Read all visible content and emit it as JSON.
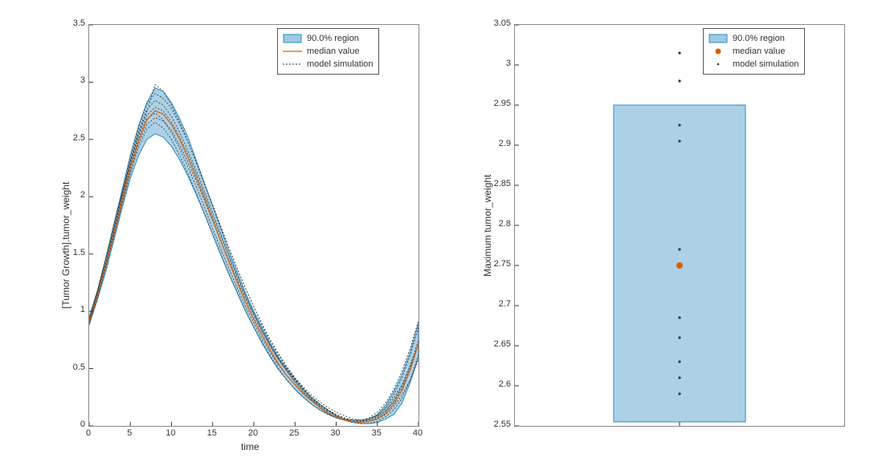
{
  "chart_data": [
    {
      "type": "line",
      "title": "",
      "xlabel": "time",
      "ylabel": "[Tumor Growth].tumor_weight",
      "xlim": [
        0,
        40
      ],
      "ylim": [
        0,
        3.5
      ],
      "xticks": [
        0,
        5,
        10,
        15,
        20,
        25,
        30,
        35,
        40
      ],
      "yticks": [
        0,
        0.5,
        1,
        1.5,
        2,
        2.5,
        3,
        3.5
      ],
      "x": [
        0,
        1,
        2,
        3,
        4,
        5,
        6,
        7,
        8,
        9,
        10,
        11,
        12,
        13,
        14,
        15,
        16,
        17,
        18,
        19,
        20,
        21,
        22,
        23,
        24,
        25,
        26,
        27,
        28,
        29,
        30,
        31,
        32,
        33,
        34,
        35,
        36,
        37,
        38,
        39,
        40
      ],
      "region_lower": [
        0.88,
        1.1,
        1.34,
        1.62,
        1.9,
        2.16,
        2.36,
        2.5,
        2.55,
        2.52,
        2.44,
        2.32,
        2.18,
        2.02,
        1.85,
        1.67,
        1.49,
        1.32,
        1.16,
        1.0,
        0.86,
        0.72,
        0.6,
        0.49,
        0.4,
        0.32,
        0.25,
        0.19,
        0.14,
        0.1,
        0.07,
        0.05,
        0.03,
        0.02,
        0.02,
        0.03,
        0.06,
        0.1,
        0.2,
        0.38,
        0.6
      ],
      "region_upper": [
        0.95,
        1.18,
        1.46,
        1.76,
        2.06,
        2.36,
        2.62,
        2.82,
        2.95,
        2.92,
        2.82,
        2.68,
        2.52,
        2.32,
        2.12,
        1.92,
        1.72,
        1.52,
        1.34,
        1.16,
        1.0,
        0.86,
        0.72,
        0.6,
        0.5,
        0.41,
        0.32,
        0.25,
        0.19,
        0.14,
        0.09,
        0.06,
        0.05,
        0.05,
        0.06,
        0.1,
        0.18,
        0.3,
        0.45,
        0.65,
        0.9
      ],
      "series": [
        {
          "name": "median value",
          "values": [
            0.91,
            1.14,
            1.4,
            1.68,
            1.97,
            2.25,
            2.49,
            2.67,
            2.75,
            2.72,
            2.63,
            2.5,
            2.34,
            2.17,
            1.99,
            1.8,
            1.61,
            1.43,
            1.25,
            1.08,
            0.93,
            0.79,
            0.66,
            0.54,
            0.44,
            0.36,
            0.28,
            0.22,
            0.16,
            0.11,
            0.08,
            0.05,
            0.04,
            0.03,
            0.04,
            0.06,
            0.11,
            0.19,
            0.31,
            0.49,
            0.72
          ]
        },
        {
          "name": "sim1",
          "values": [
            0.92,
            1.15,
            1.41,
            1.7,
            2.0,
            2.28,
            2.51,
            2.68,
            2.73,
            2.67,
            2.56,
            2.42,
            2.26,
            2.09,
            1.91,
            1.72,
            1.54,
            1.37,
            1.2,
            1.04,
            0.9,
            0.76,
            0.64,
            0.53,
            0.44,
            0.36,
            0.29,
            0.23,
            0.18,
            0.13,
            0.1,
            0.07,
            0.05,
            0.04,
            0.04,
            0.06,
            0.1,
            0.17,
            0.27,
            0.4,
            0.58
          ]
        },
        {
          "name": "sim2",
          "values": [
            0.9,
            1.12,
            1.38,
            1.66,
            1.94,
            2.22,
            2.46,
            2.63,
            2.69,
            2.66,
            2.58,
            2.45,
            2.3,
            2.14,
            1.97,
            1.79,
            1.61,
            1.44,
            1.27,
            1.11,
            0.96,
            0.82,
            0.69,
            0.58,
            0.48,
            0.39,
            0.31,
            0.24,
            0.18,
            0.13,
            0.09,
            0.06,
            0.04,
            0.03,
            0.04,
            0.07,
            0.13,
            0.22,
            0.35,
            0.53,
            0.75
          ]
        },
        {
          "name": "sim3",
          "values": [
            0.89,
            1.12,
            1.37,
            1.65,
            1.93,
            2.2,
            2.43,
            2.59,
            2.65,
            2.6,
            2.5,
            2.36,
            2.2,
            2.03,
            1.85,
            1.67,
            1.49,
            1.32,
            1.16,
            1.0,
            0.86,
            0.73,
            0.61,
            0.5,
            0.4,
            0.32,
            0.25,
            0.19,
            0.14,
            0.1,
            0.07,
            0.05,
            0.03,
            0.02,
            0.02,
            0.04,
            0.08,
            0.14,
            0.24,
            0.4,
            0.62
          ]
        },
        {
          "name": "sim4",
          "values": [
            0.93,
            1.17,
            1.44,
            1.74,
            2.03,
            2.32,
            2.57,
            2.76,
            2.84,
            2.8,
            2.7,
            2.56,
            2.4,
            2.23,
            2.05,
            1.86,
            1.67,
            1.49,
            1.31,
            1.14,
            0.98,
            0.83,
            0.7,
            0.58,
            0.48,
            0.38,
            0.3,
            0.23,
            0.17,
            0.12,
            0.08,
            0.05,
            0.04,
            0.04,
            0.06,
            0.09,
            0.16,
            0.27,
            0.42,
            0.62,
            0.86
          ]
        },
        {
          "name": "sim5",
          "values": [
            0.92,
            1.16,
            1.42,
            1.71,
            2.02,
            2.3,
            2.54,
            2.71,
            2.78,
            2.75,
            2.65,
            2.52,
            2.37,
            2.2,
            2.02,
            1.83,
            1.65,
            1.47,
            1.3,
            1.13,
            0.98,
            0.84,
            0.71,
            0.59,
            0.49,
            0.4,
            0.32,
            0.25,
            0.19,
            0.14,
            0.1,
            0.07,
            0.05,
            0.04,
            0.05,
            0.08,
            0.13,
            0.21,
            0.33,
            0.5,
            0.72
          ]
        },
        {
          "name": "sim6",
          "values": [
            0.94,
            1.18,
            1.46,
            1.76,
            2.05,
            2.35,
            2.6,
            2.81,
            2.9,
            2.86,
            2.77,
            2.63,
            2.48,
            2.3,
            2.11,
            1.93,
            1.74,
            1.55,
            1.37,
            1.2,
            1.04,
            0.88,
            0.74,
            0.62,
            0.51,
            0.41,
            0.33,
            0.25,
            0.19,
            0.14,
            0.09,
            0.06,
            0.05,
            0.05,
            0.07,
            0.12,
            0.2,
            0.32,
            0.48,
            0.68,
            0.92
          ]
        },
        {
          "name": "sim7",
          "values": [
            0.93,
            1.16,
            1.43,
            1.72,
            2.01,
            2.3,
            2.55,
            2.74,
            2.98,
            2.92,
            2.8,
            2.65,
            2.48,
            2.3,
            2.11,
            1.92,
            1.73,
            1.55,
            1.37,
            1.2,
            1.04,
            0.89,
            0.75,
            0.63,
            0.52,
            0.42,
            0.34,
            0.27,
            0.21,
            0.16,
            0.12,
            0.09,
            0.06,
            0.05,
            0.06,
            0.09,
            0.15,
            0.24,
            0.36,
            0.52,
            0.72
          ]
        }
      ],
      "legend": {
        "region": "90.0% region",
        "median": "median value",
        "sim": "model simulation"
      },
      "colors": {
        "region": "#9ec9e2",
        "region_stroke": "#2b8cbe",
        "median": "#d95f02",
        "sim": "#333"
      }
    },
    {
      "type": "scatter",
      "title": "",
      "xlabel": "",
      "ylabel": "Maximum tumor_weight",
      "ylim": [
        2.55,
        3.05
      ],
      "yticks": [
        2.55,
        2.6,
        2.65,
        2.7,
        2.75,
        2.8,
        2.85,
        2.9,
        2.95,
        3.0,
        3.05
      ],
      "region": {
        "low": 2.555,
        "high": 2.95
      },
      "median": 2.75,
      "sim_points": [
        2.59,
        2.61,
        2.63,
        2.66,
        2.685,
        2.77,
        2.905,
        2.925,
        2.98,
        3.015
      ],
      "legend": {
        "region": "90.0% region",
        "median": "median value",
        "sim": "model simulation"
      },
      "colors": {
        "region": "#9ec9e2",
        "region_stroke": "#2b8cbe",
        "median": "#d95f02",
        "sim": "#333"
      }
    }
  ]
}
